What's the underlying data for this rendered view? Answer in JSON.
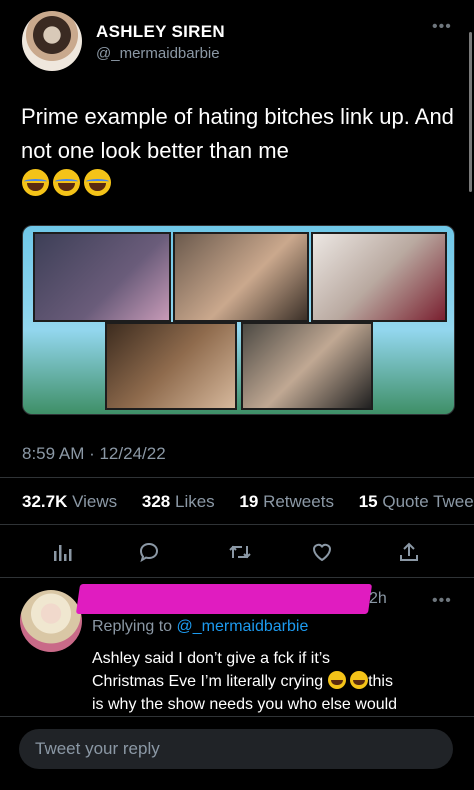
{
  "tweet": {
    "author": {
      "name": "ASHLEY SIREN",
      "handle": "@_mermaidbarbie"
    },
    "text": "Prime example of hating bitches link up. And not one look better than me",
    "emojis": [
      "joy-emoji",
      "joy-emoji",
      "joy-emoji"
    ],
    "media": {
      "tiles": [
        "participant-1",
        "participant-2",
        "participant-3",
        "participant-4",
        "participant-5"
      ]
    },
    "timestamp": "8:59 AM · 12/24/22",
    "stats": {
      "views_count": "32.7K",
      "views_label": "Views",
      "likes_count": "328",
      "likes_label": "Likes",
      "retweets_count": "19",
      "retweets_label": "Retweets",
      "quotes_count": "15",
      "quotes_label": "Quote Tweets"
    },
    "actions": [
      "analytics-icon",
      "reply-icon",
      "retweet-icon",
      "like-icon",
      "share-icon"
    ]
  },
  "reply": {
    "time": "2h",
    "replying_prefix": "Replying to",
    "replying_to": "@_mermaidbarbie",
    "text_line1": "Ashley said I don’t give a fck if it’s",
    "text_line2a": "Christmas Eve I’m literally crying ",
    "text_line2b": "this",
    "text_line3": "is why the show needs you who else would"
  },
  "composer": {
    "placeholder": "Tweet your reply"
  },
  "colors": {
    "background": "#000000",
    "accent": "#1d9bf0",
    "muted": "#8b98a5",
    "redaction": "#e01cc0"
  }
}
